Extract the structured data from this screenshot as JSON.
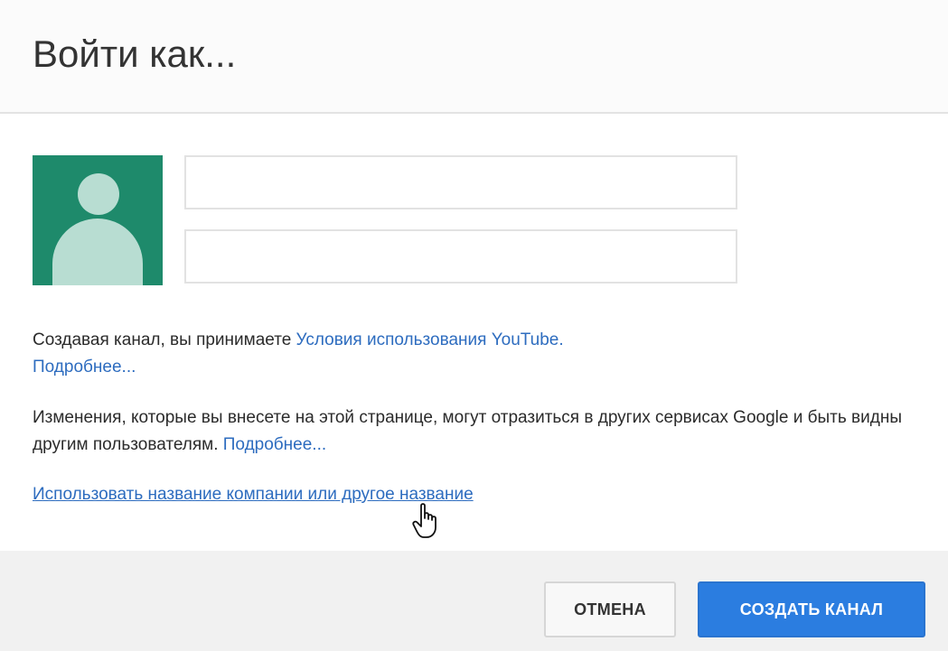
{
  "dialog": {
    "title": "Войти как..."
  },
  "form": {
    "first_name_value": "",
    "last_name_value": ""
  },
  "terms": {
    "text": "Создавая канал, вы принимаете ",
    "terms_link": "Условия использования YouTube.",
    "more_link": "Подробнее..."
  },
  "changes": {
    "text": "Изменения, которые вы внесете на этой странице, могут отразиться в других сервисах Google и быть видны другим пользователям. ",
    "more_link": "Подробнее..."
  },
  "alt_name_link": "Использовать название компании или другое название",
  "buttons": {
    "cancel": "ОТМЕНА",
    "create": "СОЗДАТЬ КАНАЛ"
  },
  "colors": {
    "avatar_bg": "#1e8a6b",
    "link": "#2d6cbf",
    "primary_button": "#2b7de0"
  },
  "icons": {
    "avatar": "person-placeholder-icon",
    "cursor": "hand-pointer-cursor-icon"
  }
}
